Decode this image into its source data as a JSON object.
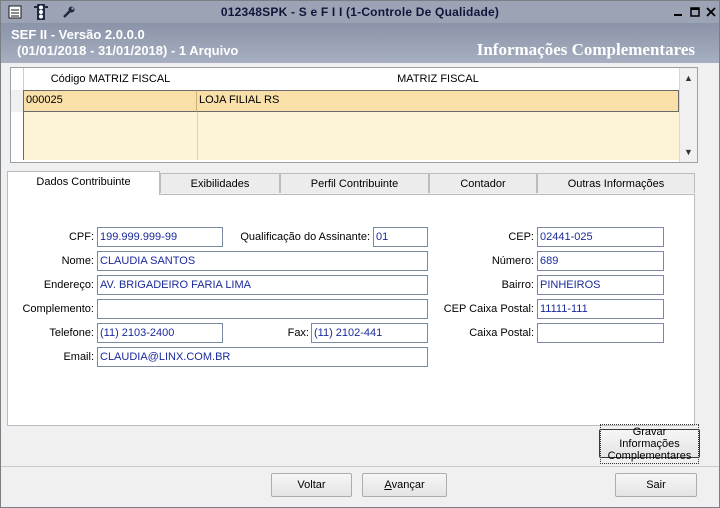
{
  "window": {
    "title": "012348SPK - S e F  I I (1-Controle De Qualidade)",
    "toolbar_icons": [
      "menu-icon",
      "traffic-light-icon",
      "wrench-icon"
    ]
  },
  "header": {
    "line1": "SEF II - Versão 2.0.0.0",
    "line2": "(01/01/2018 - 31/01/2018) - 1 Arquivo",
    "section_title": "Informações Complementares"
  },
  "grid": {
    "columns": [
      "Código MATRIZ FISCAL",
      "MATRIZ FISCAL"
    ],
    "rows": [
      {
        "codigo": "000025",
        "matriz": "LOJA FILIAL RS"
      }
    ]
  },
  "tabs": [
    {
      "label": "Dados Contribuinte",
      "active": true
    },
    {
      "label": "Exibilidades",
      "active": false
    },
    {
      "label": "Perfil Contribuinte",
      "active": false
    },
    {
      "label": "Contador",
      "active": false
    },
    {
      "label": "Outras Informações",
      "active": false
    }
  ],
  "form": {
    "cpf": {
      "label": "CPF:",
      "value": "199.999.999-99"
    },
    "qualificacao": {
      "label": "Qualificação do Assinante:",
      "value": "01"
    },
    "cep": {
      "label": "CEP:",
      "value": "02441-025"
    },
    "nome": {
      "label": "Nome:",
      "value": "CLAUDIA SANTOS"
    },
    "numero": {
      "label": "Número:",
      "value": "689"
    },
    "endereco": {
      "label": "Endereço:",
      "value": "AV. BRIGADEIRO FARIA LIMA"
    },
    "bairro": {
      "label": "Bairro:",
      "value": "PINHEIROS"
    },
    "complemento": {
      "label": "Complemento:",
      "value": ""
    },
    "cep_caixa_postal": {
      "label": "CEP Caixa Postal:",
      "value": "11111-111"
    },
    "telefone": {
      "label": "Telefone:",
      "value": "(11) 2103-2400"
    },
    "fax": {
      "label": "Fax:",
      "value": "(11) 2102-441"
    },
    "caixa_postal": {
      "label": "Caixa Postal:",
      "value": ""
    },
    "email": {
      "label": "Email:",
      "value": "CLAUDIA@LINX.COM.BR"
    }
  },
  "buttons": {
    "gravar_line1": "Gravar Informações",
    "gravar_line2": "Complementares",
    "voltar": "Voltar",
    "avancar_first": "A",
    "avancar_rest": "vançar",
    "sair": "Sair"
  }
}
